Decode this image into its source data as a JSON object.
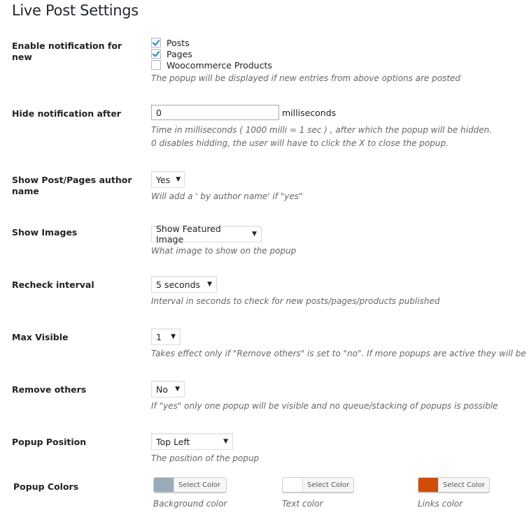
{
  "page": {
    "title": "Live Post Settings"
  },
  "settings": {
    "enable_notification": {
      "label": "Enable notification for new",
      "options": [
        {
          "label": "Posts",
          "checked": true
        },
        {
          "label": "Pages",
          "checked": true
        },
        {
          "label": "Woocommerce Products",
          "checked": false
        }
      ],
      "description": "The popup will be displayed if new entries from above options are posted"
    },
    "hide_notification": {
      "label": "Hide notification after",
      "value": "0",
      "unit": "milliseconds",
      "description_line1": "Time in milliseconds ( 1000 milli = 1 sec ) , after which the popup will be hidden.",
      "description_line2": "0 disables hidding, the user will have to click the X to close the popup."
    },
    "show_author": {
      "label": "Show Post/Pages author name",
      "selected": "Yes",
      "description": "Will add a ' by author name' if \"yes\""
    },
    "show_images": {
      "label": "Show Images",
      "selected": "Show Featured Image",
      "description": "What image to show on the popup"
    },
    "recheck_interval": {
      "label": "Recheck interval",
      "selected": "5 seconds",
      "description": "Interval in seconds to check for new posts/pages/products published"
    },
    "max_visible": {
      "label": "Max Visible",
      "selected": "1",
      "description": "Takes effect only if \"Remove others\" is set to \"no\". If more popups are active they will be queued"
    },
    "remove_others": {
      "label": "Remove others",
      "selected": "No",
      "description": "If \"yes\" only one popup will be visible and no queue/stacking of popups is possible"
    },
    "popup_position": {
      "label": "Popup Position",
      "selected": "Top Left",
      "description": "The position of the popup"
    },
    "popup_colors": {
      "label": "Popup Colors",
      "button_label": "Select Color",
      "pickers": [
        {
          "description": "Background color",
          "color": "#9aaab8"
        },
        {
          "description": "Text color",
          "color": "#ffffff"
        },
        {
          "description": "Links color",
          "color": "#d24b0a"
        }
      ]
    }
  },
  "icons": {
    "dropdown": "▼"
  }
}
